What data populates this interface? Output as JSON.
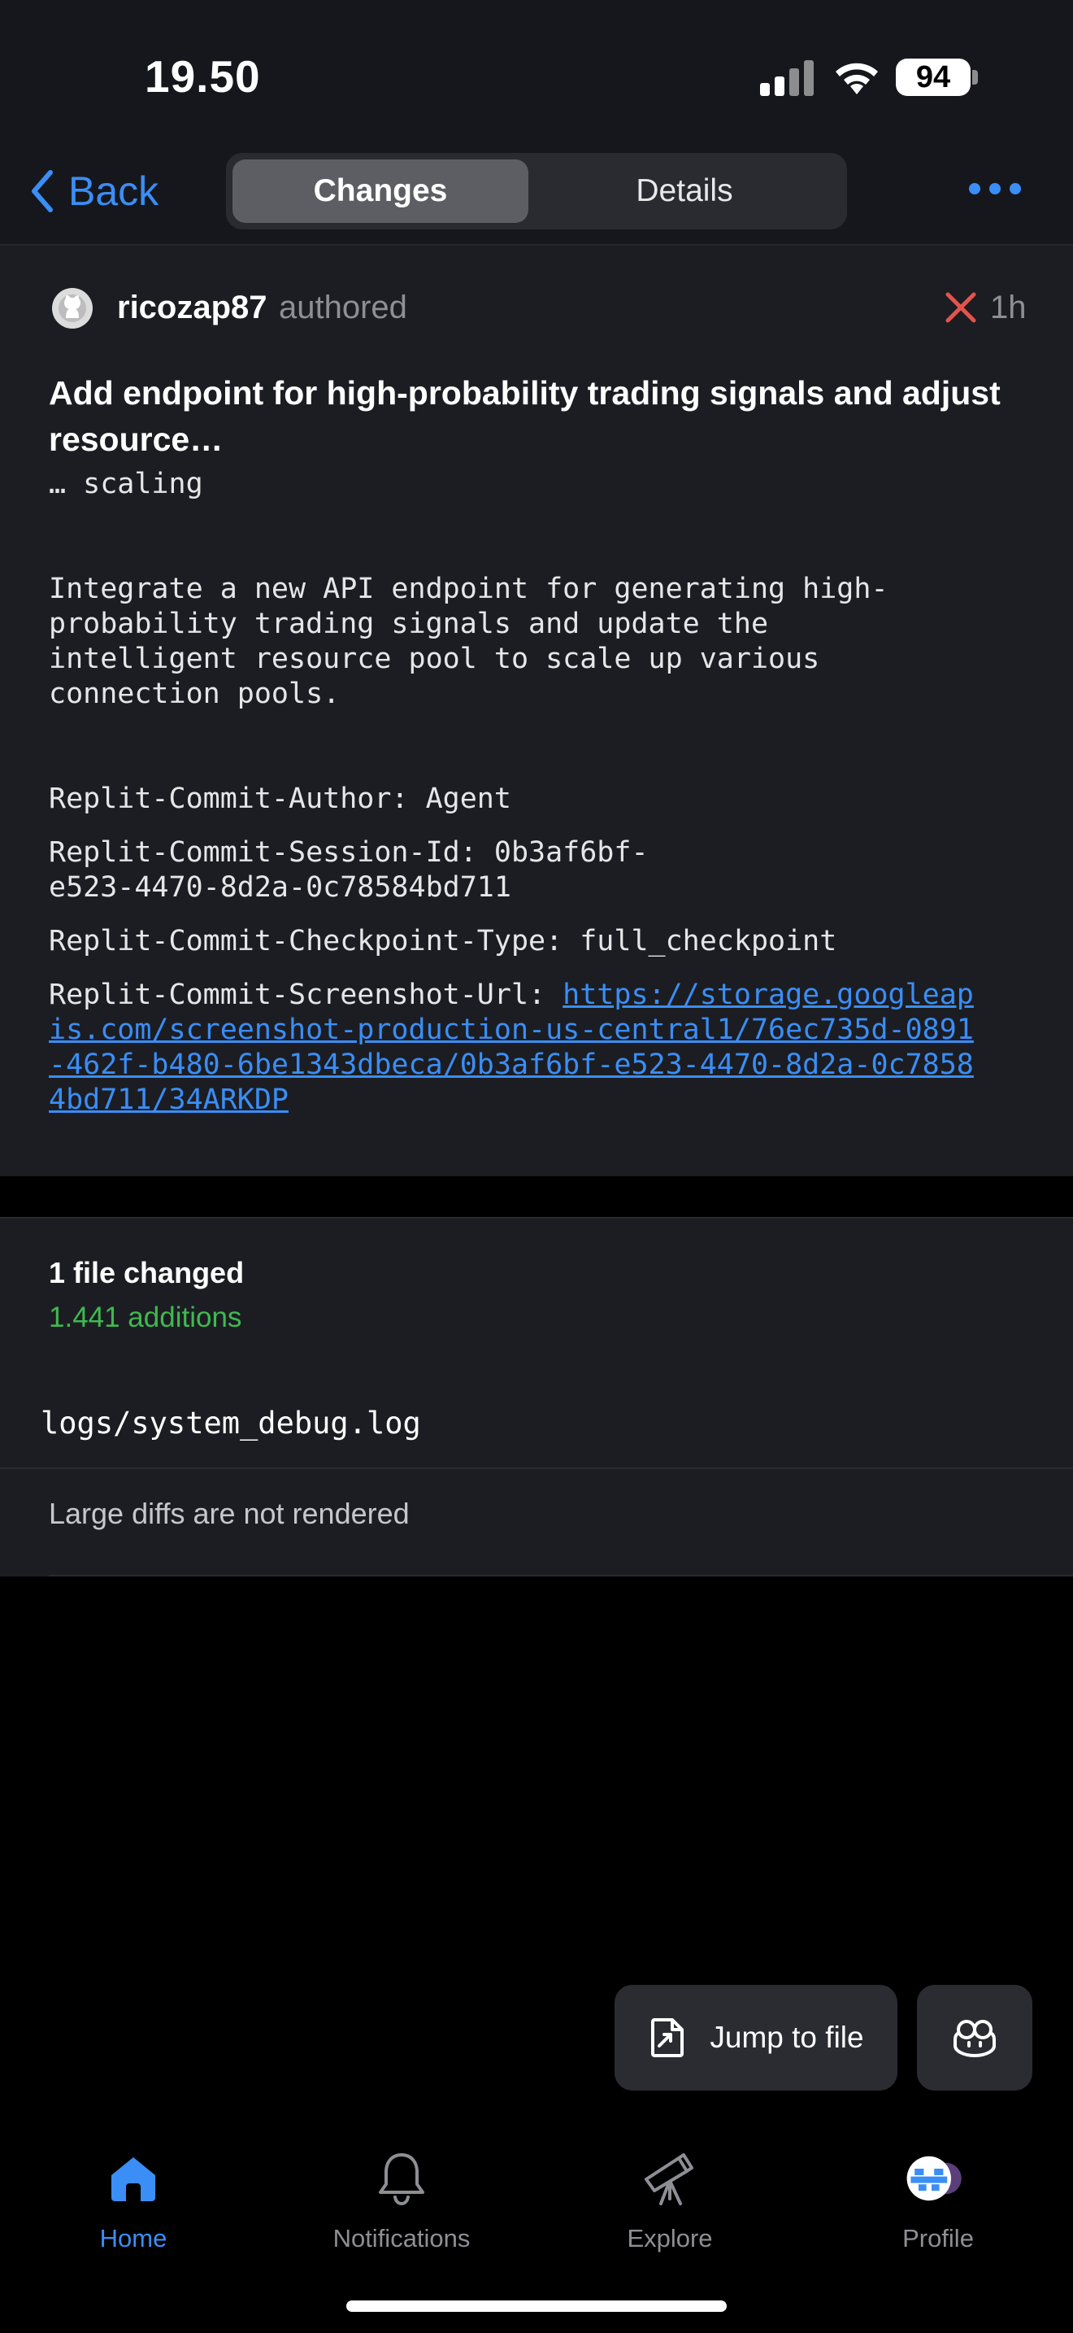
{
  "status_bar": {
    "time": "19.50",
    "battery": "94"
  },
  "nav": {
    "back_label": "Back",
    "segments": [
      "Changes",
      "Details"
    ],
    "selected_segment": "Changes",
    "accent": "#3a8ef6"
  },
  "commit": {
    "author": "ricozap87",
    "action": "authored",
    "status": "failed",
    "age": "1h",
    "title": "Add endpoint for high-probability trading signals and adjust resource…",
    "body_continuation": "… scaling",
    "description": "Integrate a new API endpoint for generating high-probability trading signals and update the intelligent resource pool to scale up various connection pools.",
    "trailer_author": "Replit-Commit-Author: Agent",
    "trailer_session": "Replit-Commit-Session-Id: 0b3af6bf-e523-4470-8d2a-0c78584bd711",
    "trailer_checkpoint": "Replit-Commit-Checkpoint-Type: full_checkpoint",
    "trailer_screenshot_label": "Replit-Commit-Screenshot-Url: ",
    "trailer_screenshot_url": "https://storage.googleapis.com/screenshot-production-us-central1/76ec735d-0891-462f-b480-6be1343dbeca/0b3af6bf-e523-4470-8d2a-0c78584bd711/34ARKDP"
  },
  "files": {
    "summary": "1 file changed",
    "additions": "1.441 additions",
    "file_path": "logs/system_debug.log",
    "diff_note": "Large diffs are not rendered"
  },
  "actions": {
    "jump_to_file": "Jump to file"
  },
  "tabs": [
    {
      "label": "Home",
      "icon": "home-icon",
      "active": true
    },
    {
      "label": "Notifications",
      "icon": "bell-icon",
      "active": false
    },
    {
      "label": "Explore",
      "icon": "telescope-icon",
      "active": false
    },
    {
      "label": "Profile",
      "icon": "avatar-icon",
      "active": false
    }
  ]
}
